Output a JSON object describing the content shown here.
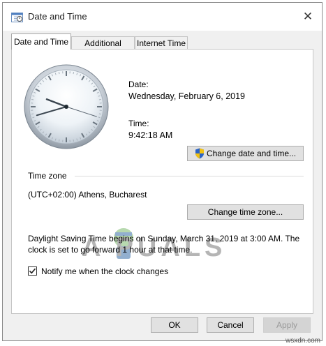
{
  "window": {
    "title": "Date and Time"
  },
  "tabs": [
    {
      "label": "Date and Time",
      "active": true
    },
    {
      "label": "Additional Clocks",
      "active": false
    },
    {
      "label": "Internet Time",
      "active": false
    }
  ],
  "clock": {
    "hour": 9,
    "minute": 42,
    "second": 18
  },
  "date": {
    "label": "Date:",
    "value": "Wednesday, February 6, 2019"
  },
  "time": {
    "label": "Time:",
    "value": "9:42:18 AM"
  },
  "buttons": {
    "change_date_time": "Change date and time...",
    "change_time_zone": "Change time zone..."
  },
  "timezone": {
    "label": "Time zone",
    "value": "(UTC+02:00) Athens, Bucharest"
  },
  "dst_text": "Daylight Saving Time begins on Sunday, March 31, 2019 at 3:00 AM. The clock is set to go forward 1 hour at that time.",
  "notify": {
    "label": "Notify me when the clock changes",
    "checked": true
  },
  "footer": {
    "ok": "OK",
    "cancel": "Cancel",
    "apply": "Apply"
  },
  "watermark": {
    "brand": "A PUALS",
    "site": "wsxdn.com"
  },
  "colors": {
    "shield_blue": "#2b63c6",
    "shield_yellow": "#f2c10f",
    "window_bg": "#f0f0f0"
  },
  "icons": {
    "title": "date-time-icon",
    "close": "close-icon",
    "uac": "uac-shield-icon",
    "check": "checkmark-icon"
  }
}
